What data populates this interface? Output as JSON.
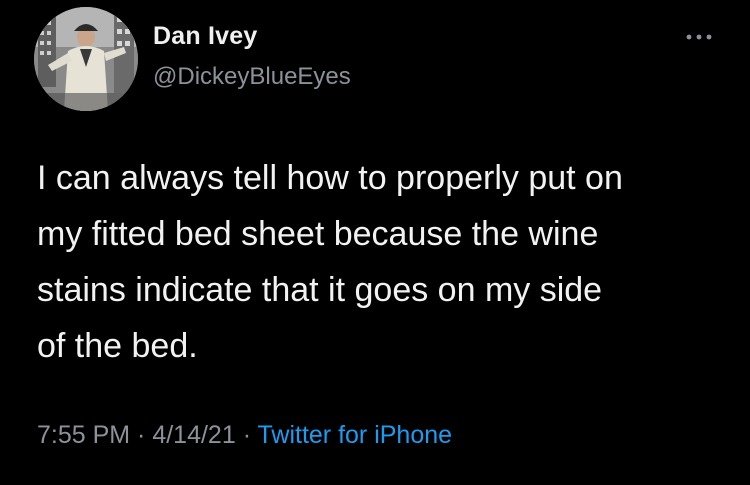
{
  "author": {
    "display_name": "Dan Ivey",
    "handle": "@DickeyBlueEyes",
    "avatar": "profile-photo-man-in-light-suit"
  },
  "menu": {
    "icon": "more-options-icon"
  },
  "tweet": {
    "text": "I can always tell how to properly put on\nmy fitted bed sheet because the wine\nstains indicate that it goes on my side\nof the bed."
  },
  "meta": {
    "time": "7:55 PM",
    "separator": " · ",
    "date": "4/14/21",
    "source": "Twitter for iPhone"
  },
  "colors": {
    "background": "#000000",
    "text": "#f2f2f2",
    "secondary_text": "#8b9299",
    "link": "#1d9bf0"
  }
}
